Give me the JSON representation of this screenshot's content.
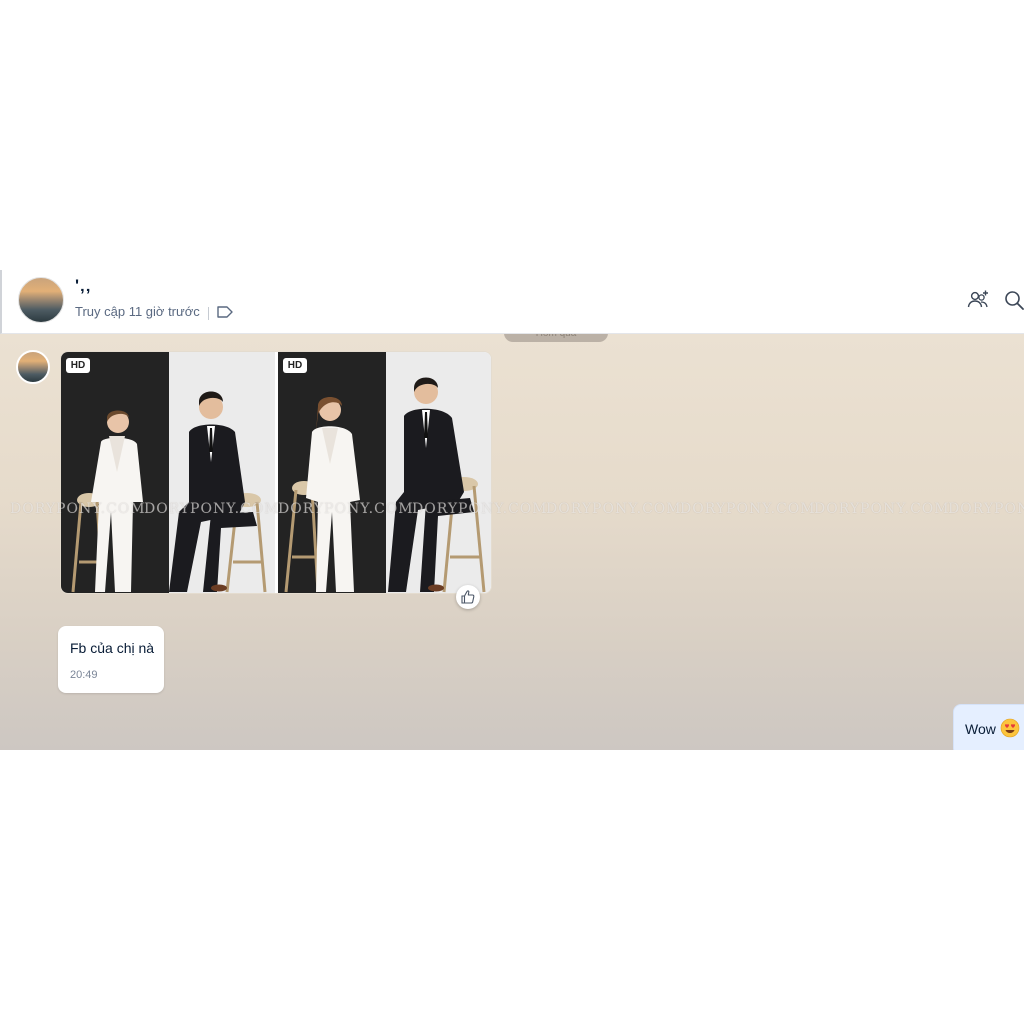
{
  "header": {
    "contact_name": "'‚‚",
    "status": "Truy cập 11 giờ trước",
    "icons": [
      "avatar-image",
      "tag-icon",
      "add-member-icon",
      "search-icon"
    ]
  },
  "date_divider": "Hôm qua",
  "messages": [
    {
      "type": "photo-group",
      "photos": [
        {
          "badge": "HD"
        },
        {
          "badge": "HD"
        }
      ],
      "reaction_icon": "thumbs-up-icon"
    },
    {
      "type": "text",
      "text": "Fb của chị nà",
      "time": "20:49"
    },
    {
      "type": "text-sent",
      "text": "Wow",
      "emoji": "heart-eyes-emoji"
    }
  ],
  "watermark": {
    "text": "DORYPONY.COM",
    "text_tail": "DORYPONY"
  },
  "colors": {
    "header_bg": "#ffffff",
    "chat_bg_top": "#ebe1d2",
    "chat_bg_bottom": "#cdc7c2",
    "sent_bubble": "#e5efff",
    "received_bubble": "#ffffff",
    "text_primary": "#081c36",
    "text_secondary": "#5a6981"
  }
}
